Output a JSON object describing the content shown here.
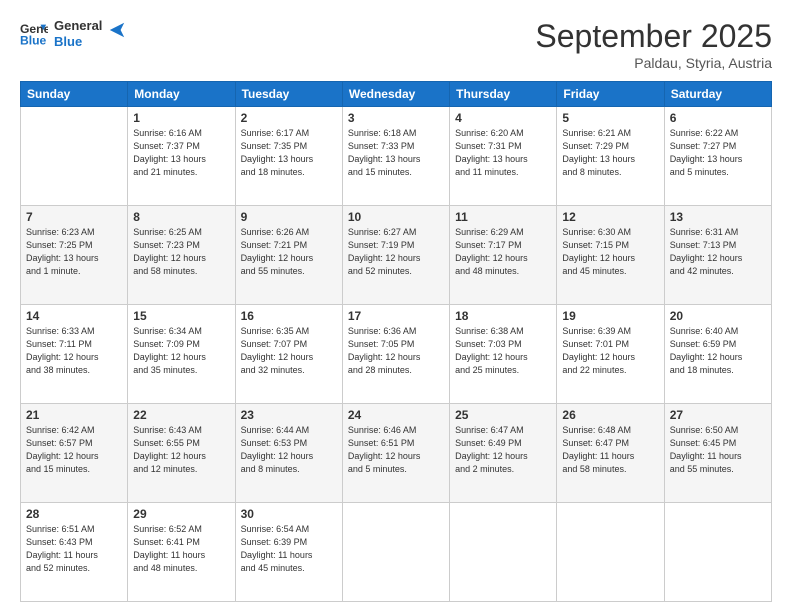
{
  "header": {
    "logo_line1": "General",
    "logo_line2": "Blue",
    "month": "September 2025",
    "location": "Paldau, Styria, Austria"
  },
  "weekdays": [
    "Sunday",
    "Monday",
    "Tuesday",
    "Wednesday",
    "Thursday",
    "Friday",
    "Saturday"
  ],
  "weeks": [
    [
      {
        "day": "",
        "info": ""
      },
      {
        "day": "1",
        "info": "Sunrise: 6:16 AM\nSunset: 7:37 PM\nDaylight: 13 hours\nand 21 minutes."
      },
      {
        "day": "2",
        "info": "Sunrise: 6:17 AM\nSunset: 7:35 PM\nDaylight: 13 hours\nand 18 minutes."
      },
      {
        "day": "3",
        "info": "Sunrise: 6:18 AM\nSunset: 7:33 PM\nDaylight: 13 hours\nand 15 minutes."
      },
      {
        "day": "4",
        "info": "Sunrise: 6:20 AM\nSunset: 7:31 PM\nDaylight: 13 hours\nand 11 minutes."
      },
      {
        "day": "5",
        "info": "Sunrise: 6:21 AM\nSunset: 7:29 PM\nDaylight: 13 hours\nand 8 minutes."
      },
      {
        "day": "6",
        "info": "Sunrise: 6:22 AM\nSunset: 7:27 PM\nDaylight: 13 hours\nand 5 minutes."
      }
    ],
    [
      {
        "day": "7",
        "info": "Sunrise: 6:23 AM\nSunset: 7:25 PM\nDaylight: 13 hours\nand 1 minute."
      },
      {
        "day": "8",
        "info": "Sunrise: 6:25 AM\nSunset: 7:23 PM\nDaylight: 12 hours\nand 58 minutes."
      },
      {
        "day": "9",
        "info": "Sunrise: 6:26 AM\nSunset: 7:21 PM\nDaylight: 12 hours\nand 55 minutes."
      },
      {
        "day": "10",
        "info": "Sunrise: 6:27 AM\nSunset: 7:19 PM\nDaylight: 12 hours\nand 52 minutes."
      },
      {
        "day": "11",
        "info": "Sunrise: 6:29 AM\nSunset: 7:17 PM\nDaylight: 12 hours\nand 48 minutes."
      },
      {
        "day": "12",
        "info": "Sunrise: 6:30 AM\nSunset: 7:15 PM\nDaylight: 12 hours\nand 45 minutes."
      },
      {
        "day": "13",
        "info": "Sunrise: 6:31 AM\nSunset: 7:13 PM\nDaylight: 12 hours\nand 42 minutes."
      }
    ],
    [
      {
        "day": "14",
        "info": "Sunrise: 6:33 AM\nSunset: 7:11 PM\nDaylight: 12 hours\nand 38 minutes."
      },
      {
        "day": "15",
        "info": "Sunrise: 6:34 AM\nSunset: 7:09 PM\nDaylight: 12 hours\nand 35 minutes."
      },
      {
        "day": "16",
        "info": "Sunrise: 6:35 AM\nSunset: 7:07 PM\nDaylight: 12 hours\nand 32 minutes."
      },
      {
        "day": "17",
        "info": "Sunrise: 6:36 AM\nSunset: 7:05 PM\nDaylight: 12 hours\nand 28 minutes."
      },
      {
        "day": "18",
        "info": "Sunrise: 6:38 AM\nSunset: 7:03 PM\nDaylight: 12 hours\nand 25 minutes."
      },
      {
        "day": "19",
        "info": "Sunrise: 6:39 AM\nSunset: 7:01 PM\nDaylight: 12 hours\nand 22 minutes."
      },
      {
        "day": "20",
        "info": "Sunrise: 6:40 AM\nSunset: 6:59 PM\nDaylight: 12 hours\nand 18 minutes."
      }
    ],
    [
      {
        "day": "21",
        "info": "Sunrise: 6:42 AM\nSunset: 6:57 PM\nDaylight: 12 hours\nand 15 minutes."
      },
      {
        "day": "22",
        "info": "Sunrise: 6:43 AM\nSunset: 6:55 PM\nDaylight: 12 hours\nand 12 minutes."
      },
      {
        "day": "23",
        "info": "Sunrise: 6:44 AM\nSunset: 6:53 PM\nDaylight: 12 hours\nand 8 minutes."
      },
      {
        "day": "24",
        "info": "Sunrise: 6:46 AM\nSunset: 6:51 PM\nDaylight: 12 hours\nand 5 minutes."
      },
      {
        "day": "25",
        "info": "Sunrise: 6:47 AM\nSunset: 6:49 PM\nDaylight: 12 hours\nand 2 minutes."
      },
      {
        "day": "26",
        "info": "Sunrise: 6:48 AM\nSunset: 6:47 PM\nDaylight: 11 hours\nand 58 minutes."
      },
      {
        "day": "27",
        "info": "Sunrise: 6:50 AM\nSunset: 6:45 PM\nDaylight: 11 hours\nand 55 minutes."
      }
    ],
    [
      {
        "day": "28",
        "info": "Sunrise: 6:51 AM\nSunset: 6:43 PM\nDaylight: 11 hours\nand 52 minutes."
      },
      {
        "day": "29",
        "info": "Sunrise: 6:52 AM\nSunset: 6:41 PM\nDaylight: 11 hours\nand 48 minutes."
      },
      {
        "day": "30",
        "info": "Sunrise: 6:54 AM\nSunset: 6:39 PM\nDaylight: 11 hours\nand 45 minutes."
      },
      {
        "day": "",
        "info": ""
      },
      {
        "day": "",
        "info": ""
      },
      {
        "day": "",
        "info": ""
      },
      {
        "day": "",
        "info": ""
      }
    ]
  ]
}
